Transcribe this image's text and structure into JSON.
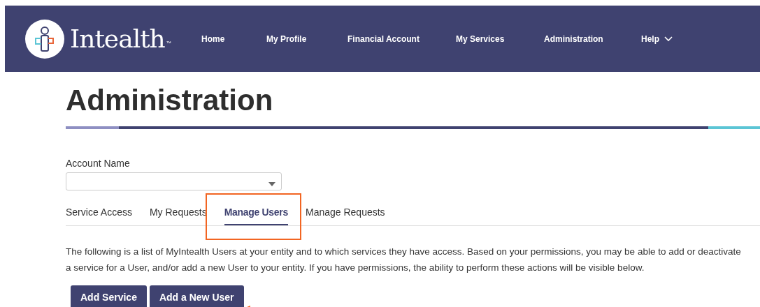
{
  "header": {
    "brand": "Intealth",
    "trademark": "™",
    "nav": [
      {
        "label": "Home",
        "has_menu": false
      },
      {
        "label": "My Profile",
        "has_menu": false
      },
      {
        "label": "Financial Account",
        "has_menu": false
      },
      {
        "label": "My Services",
        "has_menu": false
      },
      {
        "label": "Administration",
        "has_menu": false
      },
      {
        "label": "Help",
        "has_menu": true
      }
    ]
  },
  "page_title": "Administration",
  "account_field": {
    "label": "Account Name"
  },
  "tabs": [
    {
      "label": "Service Access",
      "selected": false
    },
    {
      "label": "My Requests",
      "selected": false
    },
    {
      "label": "Manage Users",
      "selected": true
    },
    {
      "label": "Manage Requests",
      "selected": false
    }
  ],
  "description": "The following is a list of MyIntealth Users at your entity and to which services they have access. Based on your permissions, you may be able to add or deactivate a service for a User, and/or add a new User to your entity. If you have permissions, the ability to perform these actions will be visible below.",
  "buttons": [
    "Add Service",
    "Add a New User"
  ]
}
